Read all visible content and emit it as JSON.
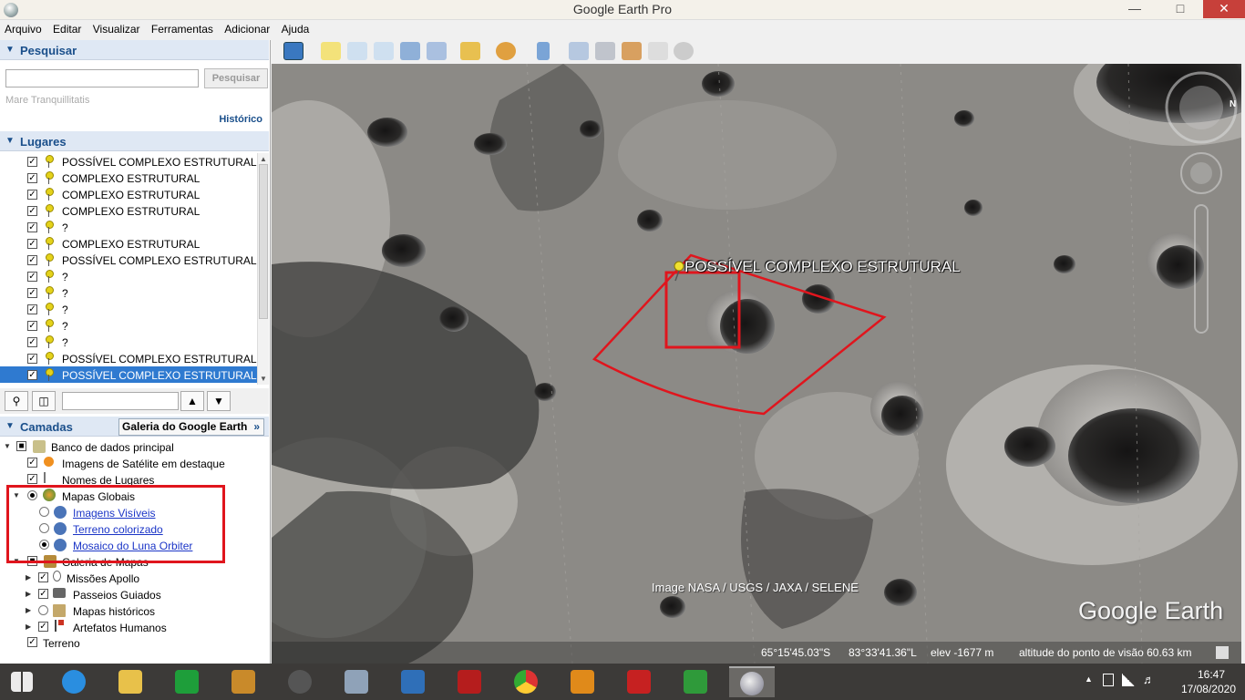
{
  "window": {
    "title": "Google Earth Pro"
  },
  "menu": [
    "Arquivo",
    "Editar",
    "Visualizar",
    "Ferramentas",
    "Adicionar",
    "Ajuda"
  ],
  "search": {
    "header": "Pesquisar",
    "value": "",
    "button_label": "Pesquisar",
    "hint": "Mare Tranquillitatis",
    "history_label": "Histórico"
  },
  "places": {
    "header": "Lugares",
    "items": [
      {
        "label": "POSSÍVEL COMPLEXO ESTRUTURAL",
        "checked": true,
        "selected": false
      },
      {
        "label": "COMPLEXO ESTRUTURAL",
        "checked": true,
        "selected": false
      },
      {
        "label": "COMPLEXO ESTRUTURAL",
        "checked": true,
        "selected": false
      },
      {
        "label": "COMPLEXO ESTRUTURAL",
        "checked": true,
        "selected": false
      },
      {
        "label": "?",
        "checked": true,
        "selected": false
      },
      {
        "label": "COMPLEXO ESTRUTURAL",
        "checked": true,
        "selected": false
      },
      {
        "label": "POSSÍVEL COMPLEXO ESTRUTURAL",
        "checked": true,
        "selected": false
      },
      {
        "label": "?",
        "checked": true,
        "selected": false
      },
      {
        "label": "?",
        "checked": true,
        "selected": false
      },
      {
        "label": "?",
        "checked": true,
        "selected": false
      },
      {
        "label": "?",
        "checked": true,
        "selected": false
      },
      {
        "label": "?",
        "checked": true,
        "selected": false
      },
      {
        "label": "POSSÍVEL COMPLEXO ESTRUTURAL",
        "checked": true,
        "selected": false
      },
      {
        "label": "POSSÍVEL COMPLEXO ESTRUTURAL",
        "checked": true,
        "selected": true
      }
    ],
    "filter_value": ""
  },
  "layers": {
    "header": "Camadas",
    "gallery_label": "Galeria do Google Earth",
    "items": [
      {
        "label": "Banco de dados principal"
      },
      {
        "label": "Imagens de Satélite em destaque"
      },
      {
        "label": "Nomes de Lugares"
      },
      {
        "label": "Mapas Globais"
      },
      {
        "label": "Imagens Visíveis"
      },
      {
        "label": "Terreno colorizado"
      },
      {
        "label": "Mosaico do Luna Orbiter"
      },
      {
        "label": "Galeria de Mapas"
      },
      {
        "label": "Missões Apollo"
      },
      {
        "label": "Passeios Guiados"
      },
      {
        "label": "Mapas históricos"
      },
      {
        "label": "Artefatos Humanos"
      },
      {
        "label": "Terreno"
      }
    ]
  },
  "map": {
    "placemark_label": "POSSÍVEL COMPLEXO ESTRUTURAL",
    "imagery_credit": "Image NASA / USGS / JAXA / SELENE",
    "logo": "Google Earth",
    "compass_letter": "N",
    "status": {
      "latitude": "65°15'45.03\"S",
      "longitude": "83°33'41.36\"L",
      "elevation": "elev -1677 m",
      "eye_altitude": "altitude do ponto de visão  60.63 km"
    }
  },
  "taskbar": {
    "apps": [
      "start",
      "internet-explorer",
      "file-explorer",
      "store",
      "app-orange",
      "app-speaker",
      "app-doc",
      "app-blue",
      "power-app",
      "chrome",
      "spreadsheet-s",
      "text-t",
      "presentation-p",
      "google-earth"
    ],
    "time": "16:47",
    "date": "17/08/2020"
  },
  "colors": {
    "selection": "#2f7ad0",
    "annotation_red": "#e0151d",
    "header_blue": "#1a4f8b",
    "link": "#1b35c7"
  }
}
